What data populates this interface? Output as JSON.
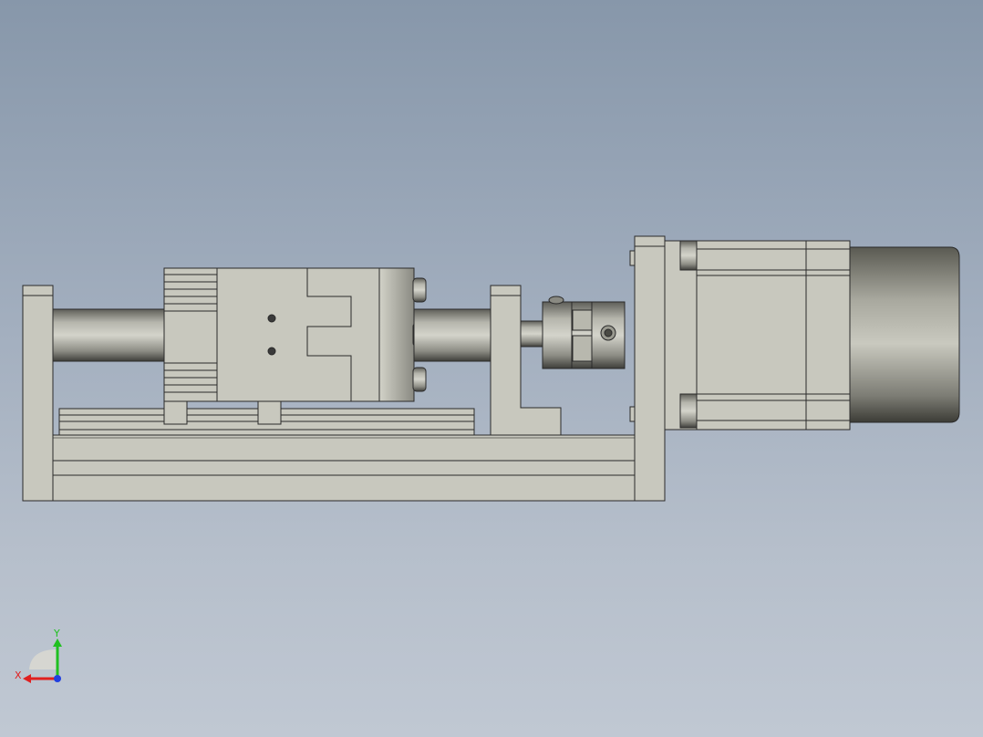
{
  "viewport": {
    "description_colors": {
      "background_top": "#8797aa",
      "background_bottom": "#c0c8d3",
      "part_fill": "#c8c8be",
      "part_stroke": "#2a2a2a",
      "axis_x_color": "#e02020",
      "axis_y_color": "#20c020",
      "axis_z_color": "#2040e0"
    }
  },
  "triad": {
    "x_label": "X",
    "y_label": "Y"
  },
  "icons": {
    "triad": "coordinate-triad-icon"
  }
}
